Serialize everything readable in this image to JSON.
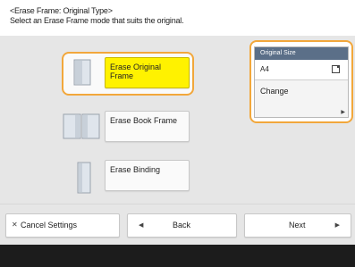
{
  "header": {
    "line1": "<Erase Frame: Original Type>",
    "line2": "Select an Erase Frame mode that suits the original."
  },
  "modes": [
    {
      "label": "Erase Original Frame",
      "icon": "single-document-icon",
      "selected": true
    },
    {
      "label": "Erase Book Frame",
      "icon": "open-book-icon",
      "selected": false
    },
    {
      "label": "Erase Binding",
      "icon": "binding-document-icon",
      "selected": false
    }
  ],
  "original_size": {
    "title": "Original Size",
    "value": "A4",
    "icon": "page-orientation-icon",
    "change_label": "Change",
    "arrow_icon": "triangle-right-icon"
  },
  "footer": {
    "cancel_label": "Cancel Settings",
    "back_label": "Back",
    "next_label": "Next"
  },
  "colors": {
    "selected": "#fff200",
    "focus_ring": "#f2a73b",
    "panel": "#e6e6e6",
    "title_bar": "#5b6f88"
  }
}
